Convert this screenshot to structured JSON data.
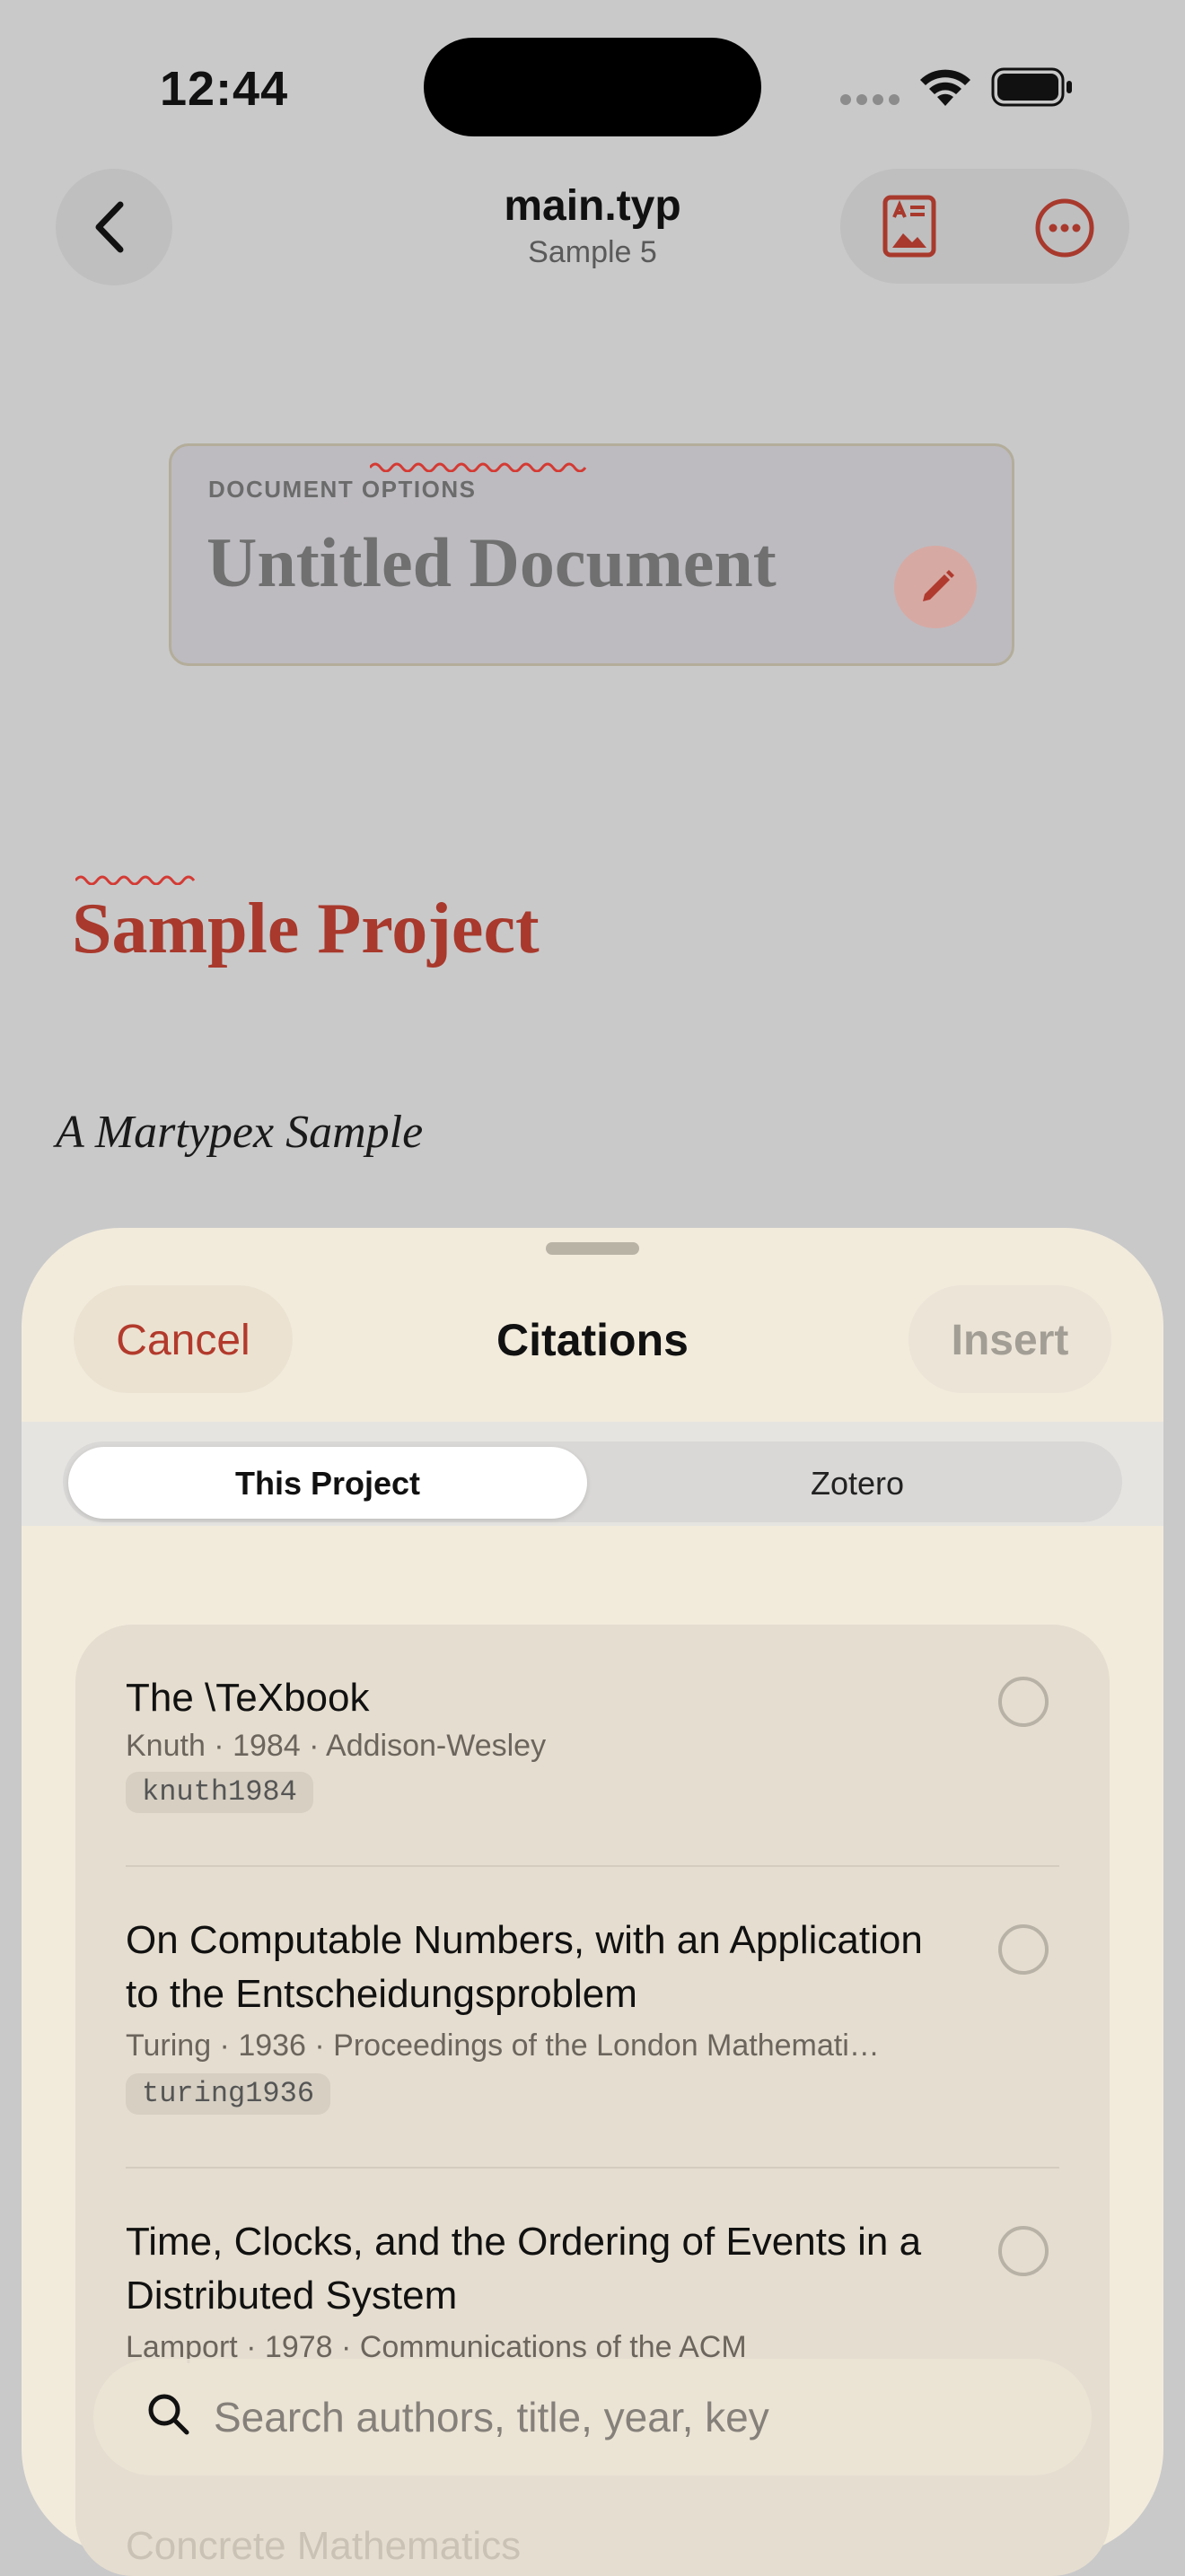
{
  "status": {
    "time": "12:44"
  },
  "nav": {
    "title": "main.typ",
    "subtitle": "Sample 5"
  },
  "document_options": {
    "label": "DOCUMENT OPTIONS",
    "title": "Untitled Document"
  },
  "project": {
    "title": "Sample Project",
    "subtitle": "A Martypex Sample"
  },
  "sheet": {
    "cancel": "Cancel",
    "title": "Citations",
    "insert": "Insert",
    "segments": [
      "This Project",
      "Zotero"
    ],
    "selected_segment": "This Project"
  },
  "citations": [
    {
      "title": "The \\TeXbook",
      "meta": "Knuth · 1984 · Addison-Wesley",
      "key": "knuth1984"
    },
    {
      "title": "On Computable Numbers, with an Application to the Entscheidungsproblem",
      "meta": "Turing · 1936 · Proceedings of the London Mathemati…",
      "key": "turing1936"
    },
    {
      "title": "Time, Clocks, and the Ordering of Events in a Distributed System",
      "meta": "Lamport · 1978 · Communications of the ACM",
      "key": ""
    },
    {
      "title": "Concrete Mathematics",
      "meta": "",
      "key": ""
    }
  ],
  "search": {
    "placeholder": "Search authors, title, year, key"
  },
  "colors": {
    "accent": "#a8392c",
    "sheet_bg": "#f2ebdc",
    "list_bg": "#e5ddcf"
  }
}
